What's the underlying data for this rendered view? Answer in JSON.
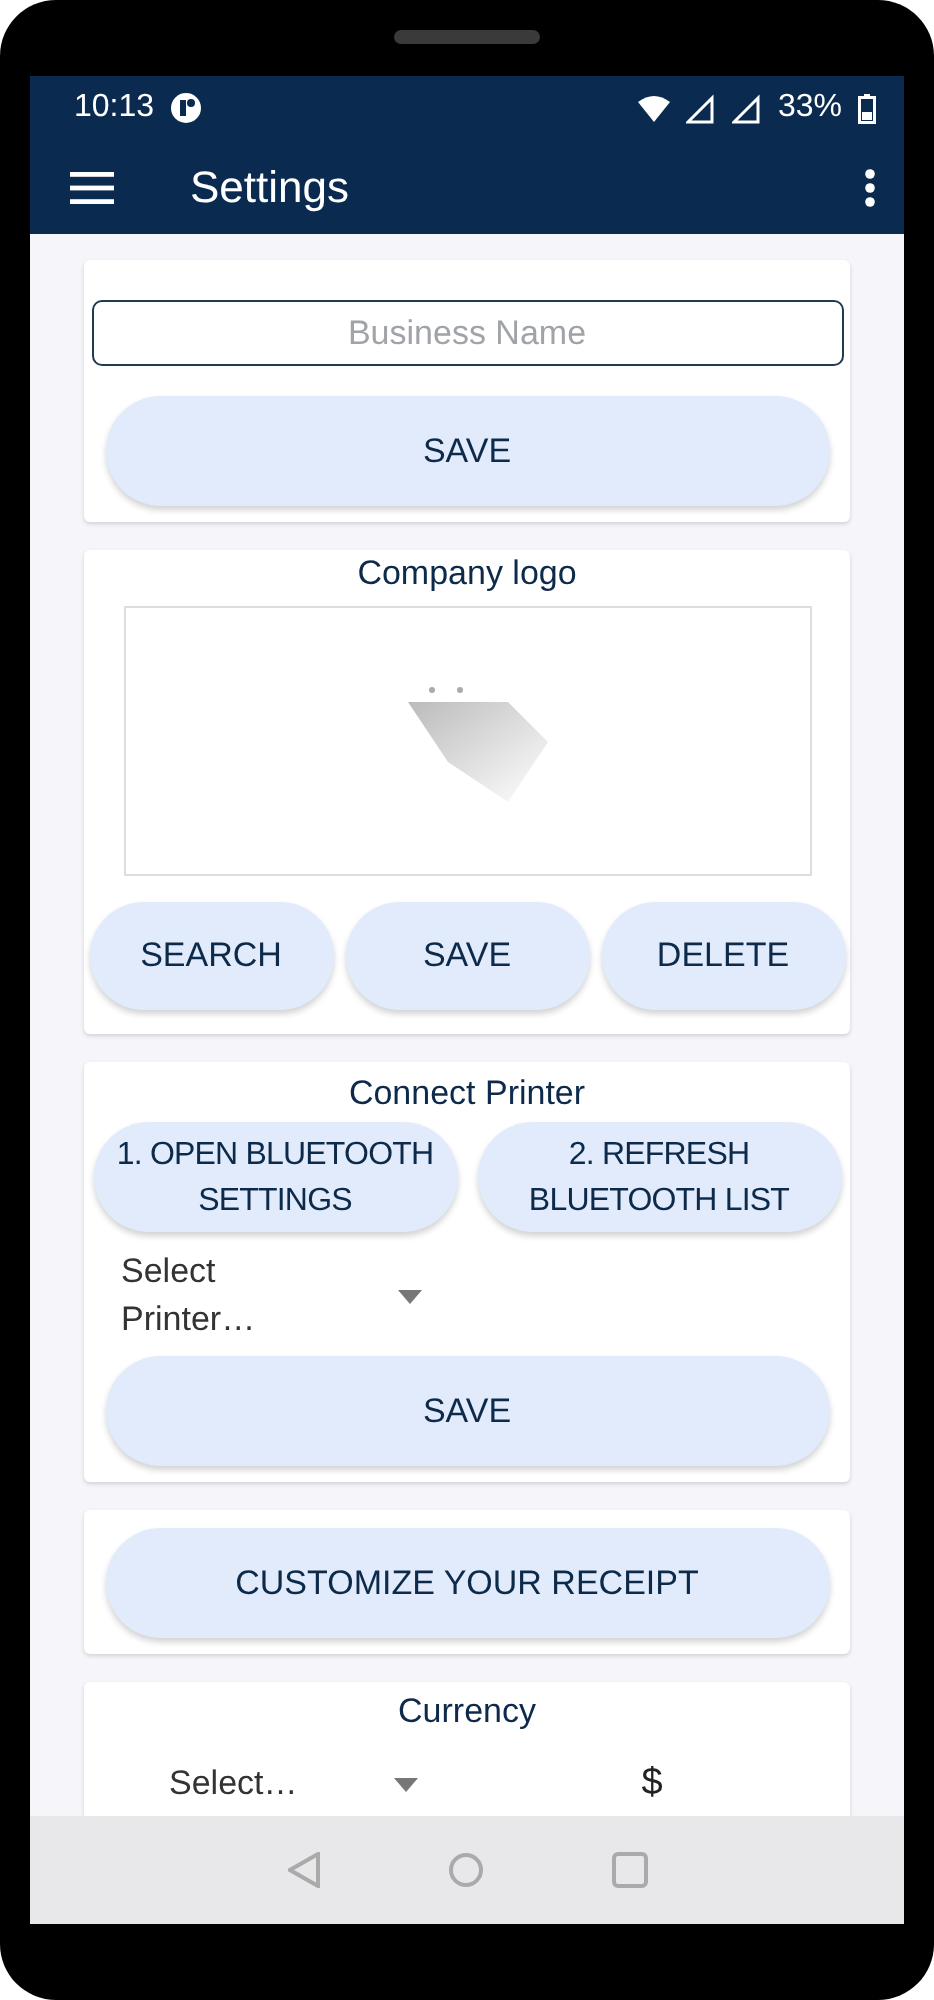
{
  "status_bar": {
    "time": "10:13",
    "battery": "33%"
  },
  "app_bar": {
    "title": "Settings"
  },
  "business": {
    "placeholder": "Business Name",
    "button": "SAVE"
  },
  "logo": {
    "title": "Company logo",
    "buttons": [
      "SEARCH",
      "SAVE",
      "DELETE"
    ]
  },
  "printer": {
    "title": "Connect Printer",
    "buttons": [
      "1. OPEN BLUETOOTH SETTINGS",
      "2. REFRESH BLUETOOTH LIST"
    ],
    "select": "Select Printer…",
    "button": "SAVE"
  },
  "receipt": {
    "button": "CUSTOMIZE YOUR RECEIPT"
  },
  "currency": {
    "title": "Currency",
    "select": "Select…",
    "symbol": "$"
  }
}
